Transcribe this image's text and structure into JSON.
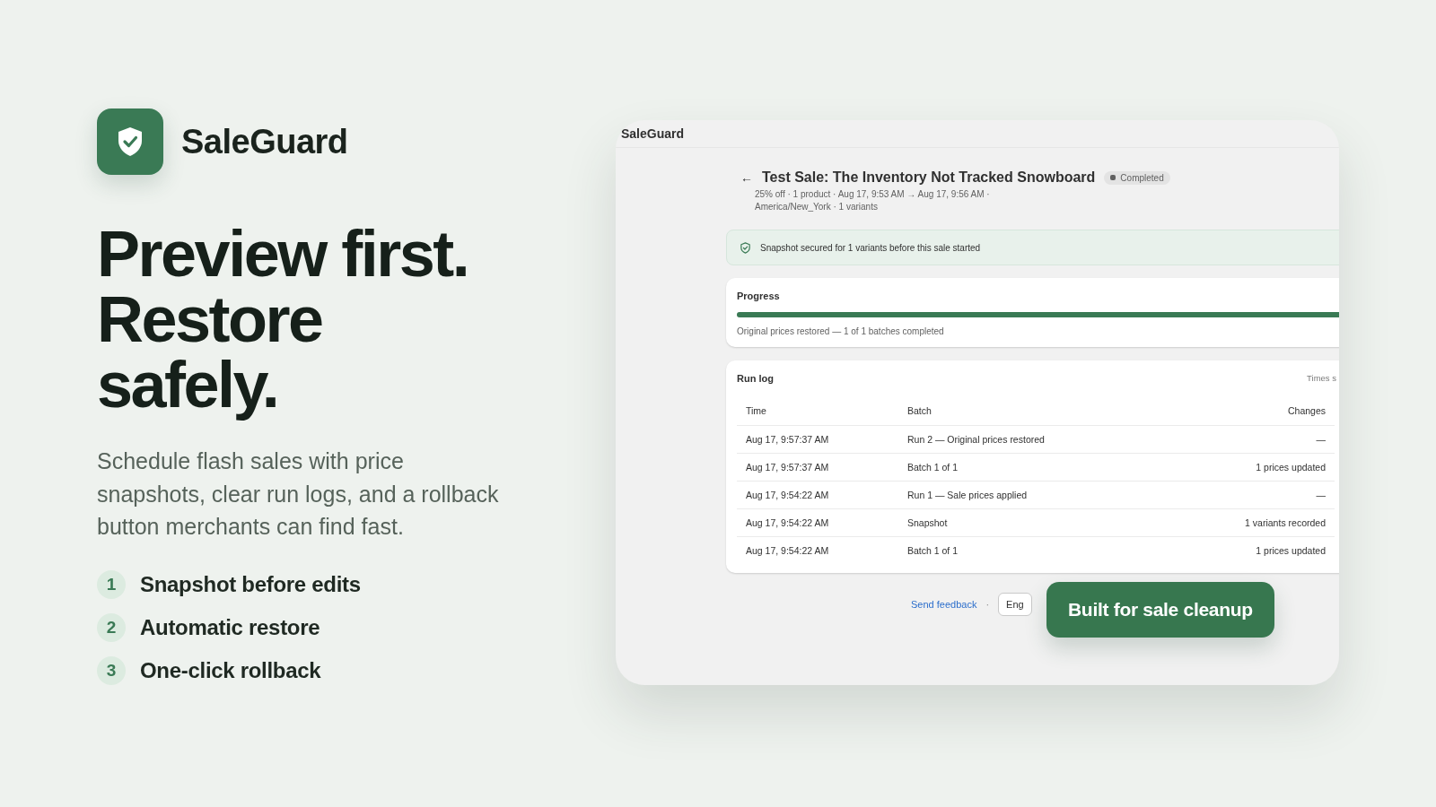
{
  "brand": {
    "name": "SaleGuard"
  },
  "headline": [
    "Preview first.",
    "Restore",
    "safely."
  ],
  "description": "Schedule flash sales with price snapshots, clear run logs, and a rollback button merchants can find fast.",
  "features": [
    {
      "number": "1",
      "label": "Snapshot before edits"
    },
    {
      "number": "2",
      "label": "Automatic restore"
    },
    {
      "number": "3",
      "label": "One-click rollback"
    }
  ],
  "app": {
    "header_title": "SaleGuard",
    "back_icon": "←",
    "title": "Test Sale: The Inventory Not Tracked Snowboard",
    "status": "Completed",
    "meta": [
      "25% off · 1 product · Aug 17, 9:53 AM → Aug 17, 9:56 AM ·",
      "America/New_York · 1 variants"
    ],
    "banner": "Snapshot secured for 1 variants before this sale started",
    "progress": {
      "title": "Progress",
      "level": 1,
      "caption": "Original prices restored — 1 of 1 batches completed"
    },
    "run_log": {
      "title": "Run log",
      "note": "Times s",
      "columns": [
        "Time",
        "Batch",
        "Changes"
      ],
      "rows": [
        [
          "Aug 17, 9:57:37 AM",
          "Run 2 — Original prices restored",
          "—"
        ],
        [
          "Aug 17, 9:57:37 AM",
          "Batch 1 of 1",
          "1 prices updated"
        ],
        [
          "Aug 17, 9:54:22 AM",
          "Run 1 — Sale prices applied",
          "—"
        ],
        [
          "Aug 17, 9:54:22 AM",
          "Snapshot",
          "1 variants recorded"
        ],
        [
          "Aug 17, 9:54:22 AM",
          "Batch 1 of 1",
          "1 prices updated"
        ]
      ]
    },
    "footer": {
      "link": "Send feedback",
      "separator": "·",
      "language": "Eng"
    }
  },
  "callout": "Built for sale cleanup"
}
